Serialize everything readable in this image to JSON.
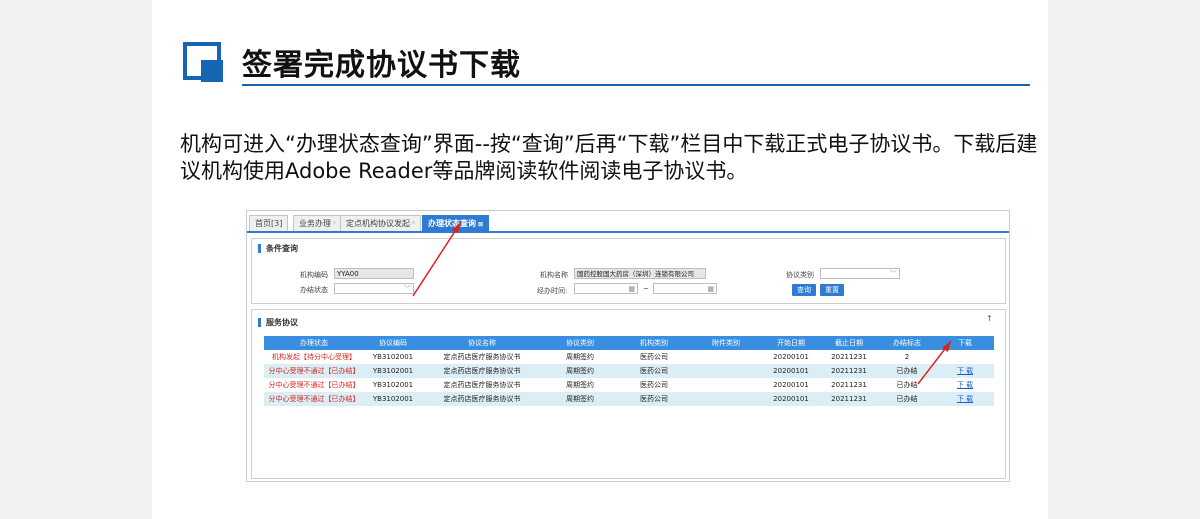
{
  "header": {
    "title": "签署完成协议书下载",
    "description": "机构可进入“办理状态查询”界面--按“查询”后再“下载”栏目中下载正式电子协议书。下载后建议机构使用Adobe Reader等品牌阅读软件阅读电子协议书。"
  },
  "tabs": [
    {
      "label": "首页[3]"
    },
    {
      "label": "业务办理"
    },
    {
      "label": "定点机构协议发起"
    },
    {
      "label": "办理状态查询",
      "active": true
    }
  ],
  "query_panel": {
    "title": "条件查询",
    "org_code_label": "机构编码",
    "org_code_value": "YYA00",
    "org_name_label": "机构名称",
    "org_name_value": "国药控股国大药房（深圳）连锁有限公司",
    "agreement_type_label": "协议类别",
    "status_label": "办结状态",
    "handle_time_label": "经办时间:",
    "tilde": "~",
    "query_button": "查询",
    "reset_button": "重置"
  },
  "service_panel": {
    "title": "服务协议",
    "columns": [
      "办理状态",
      "协议编码",
      "协议名称",
      "协议类别",
      "机构类别",
      "附件类别",
      "开始日期",
      "截止日期",
      "办结标志",
      "下载"
    ],
    "rows": [
      {
        "status": "机构发起【待分中心受理】",
        "code": "YB3102001",
        "name": "定点药店医疗服务协议书",
        "type": "周期签约",
        "org_type": "医药公司",
        "attach": "",
        "start": "20200101",
        "end": "20211231",
        "flag": "2",
        "download": ""
      },
      {
        "status": "分中心受理不通过【已办结】",
        "code": "YB3102001",
        "name": "定点药店医疗服务协议书",
        "type": "周期签约",
        "org_type": "医药公司",
        "attach": "",
        "start": "20200101",
        "end": "20211231",
        "flag": "已办结",
        "download": "下 载"
      },
      {
        "status": "分中心受理不通过【已办结】",
        "code": "YB3102001",
        "name": "定点药店医疗服务协议书",
        "type": "周期签约",
        "org_type": "医药公司",
        "attach": "",
        "start": "20200101",
        "end": "20211231",
        "flag": "已办结",
        "download": "下 载"
      },
      {
        "status": "分中心受理不通过【已办结】",
        "code": "YB3102001",
        "name": "定点药店医疗服务协议书",
        "type": "周期签约",
        "org_type": "医药公司",
        "attach": "",
        "start": "20200101",
        "end": "20211231",
        "flag": "已办结",
        "download": "下 载"
      }
    ]
  },
  "colors": {
    "accent": "#2f7bd1",
    "header_blue": "#1565b3",
    "status_red": "#d9261c",
    "arrow_red": "#e02020"
  },
  "icons": {
    "scroll_up": "↑",
    "dropdown": "﹀",
    "calendar": "▦"
  }
}
